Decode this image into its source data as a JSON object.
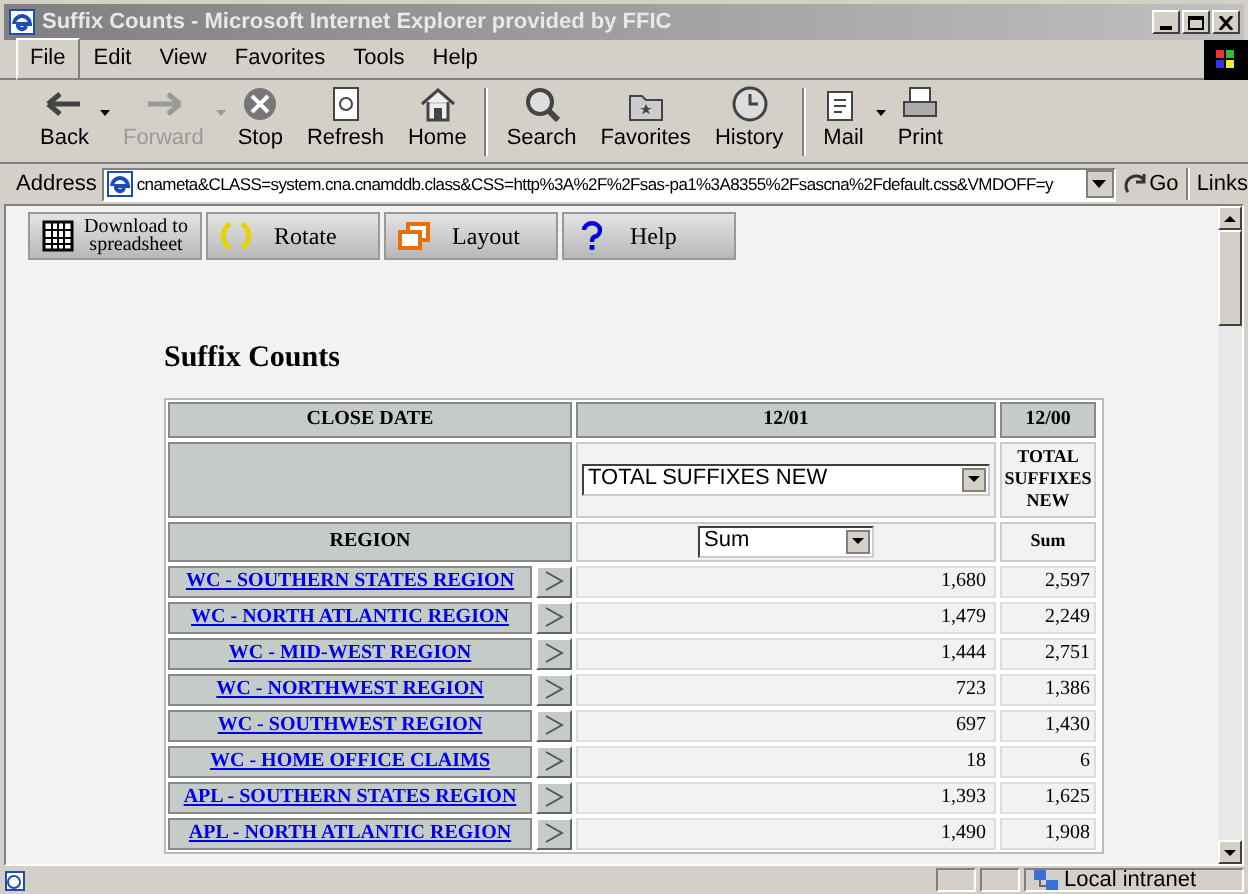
{
  "window": {
    "title": "Suffix Counts - Microsoft Internet Explorer provided by FFIC"
  },
  "menu": [
    {
      "label": "File",
      "selected": true
    },
    {
      "label": "Edit",
      "selected": false
    },
    {
      "label": "View",
      "selected": false
    },
    {
      "label": "Favorites",
      "selected": false
    },
    {
      "label": "Tools",
      "selected": false
    },
    {
      "label": "Help",
      "selected": false
    }
  ],
  "toolbar": [
    {
      "label": "Back",
      "kind": "back",
      "disabled": false,
      "dropdown": true
    },
    {
      "label": "Forward",
      "kind": "forward",
      "disabled": true,
      "dropdown": true
    },
    {
      "label": "Stop",
      "kind": "stop",
      "disabled": false,
      "dropdown": false
    },
    {
      "label": "Refresh",
      "kind": "refresh",
      "disabled": false,
      "dropdown": false
    },
    {
      "label": "Home",
      "kind": "home",
      "disabled": false,
      "dropdown": false
    },
    {
      "label": "Search",
      "kind": "search",
      "disabled": false,
      "dropdown": false
    },
    {
      "label": "Favorites",
      "kind": "favorites",
      "disabled": false,
      "dropdown": false
    },
    {
      "label": "History",
      "kind": "history",
      "disabled": false,
      "dropdown": false
    },
    {
      "label": "Mail",
      "kind": "mail",
      "disabled": false,
      "dropdown": true
    },
    {
      "label": "Print",
      "kind": "print",
      "disabled": false,
      "dropdown": false
    }
  ],
  "address": {
    "label": "Address",
    "value": "cnameta&CLASS=system.cna.cnamddb.class&CSS=http%3A%2F%2Fsas-pa1%3A8355%2Fsascna%2Fdefault.css&VMDOFF=y",
    "go": "Go",
    "links": "Links"
  },
  "page_toolbar": [
    {
      "label": "Download to spreadsheet",
      "kind": "grid"
    },
    {
      "label": "Rotate",
      "kind": "rotate"
    },
    {
      "label": "Layout",
      "kind": "layout"
    },
    {
      "label": "Help",
      "kind": "help"
    }
  ],
  "heading": "Suffix Counts",
  "table": {
    "close_date_label": "CLOSE DATE",
    "col_1": "12/01",
    "col_2": "12/00",
    "measure_select": "TOTAL SUFFIXES NEW",
    "measure_header": "TOTAL SUFFIXES NEW",
    "region_label": "REGION",
    "stat_select": "Sum",
    "stat_header": "Sum",
    "rows": [
      {
        "region": "WC - SOUTHERN STATES REGION",
        "col_1": "1,680",
        "col_2": "2,597"
      },
      {
        "region": "WC - NORTH ATLANTIC REGION",
        "col_1": "1,479",
        "col_2": "2,249"
      },
      {
        "region": "WC - MID-WEST REGION",
        "col_1": "1,444",
        "col_2": "2,751"
      },
      {
        "region": "WC - NORTHWEST REGION",
        "col_1": "723",
        "col_2": "1,386"
      },
      {
        "region": "WC - SOUTHWEST REGION",
        "col_1": "697",
        "col_2": "1,430"
      },
      {
        "region": "WC - HOME OFFICE CLAIMS",
        "col_1": "18",
        "col_2": "6"
      },
      {
        "region": "APL - SOUTHERN STATES REGION",
        "col_1": "1,393",
        "col_2": "1,625"
      },
      {
        "region": "APL - NORTH ATLANTIC REGION",
        "col_1": "1,490",
        "col_2": "1,908"
      }
    ]
  },
  "status_bar": {
    "zone": "Local intranet"
  }
}
